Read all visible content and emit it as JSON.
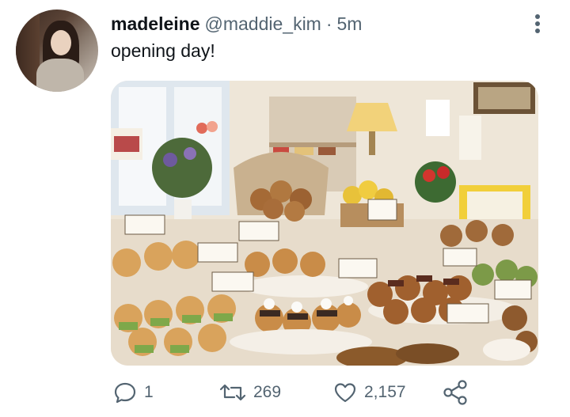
{
  "tweet": {
    "display_name": "madeleine",
    "handle": "@maddie_kim",
    "separator": "·",
    "time": "5m",
    "text": "opening day!"
  },
  "actions": {
    "reply_count": "1",
    "retweet_count": "269",
    "like_count": "2,157"
  },
  "colors": {
    "text_primary": "#0f1419",
    "text_secondary": "#536471"
  },
  "icons": [
    "more-options-icon",
    "reply-icon",
    "retweet-icon",
    "like-icon",
    "share-icon"
  ]
}
